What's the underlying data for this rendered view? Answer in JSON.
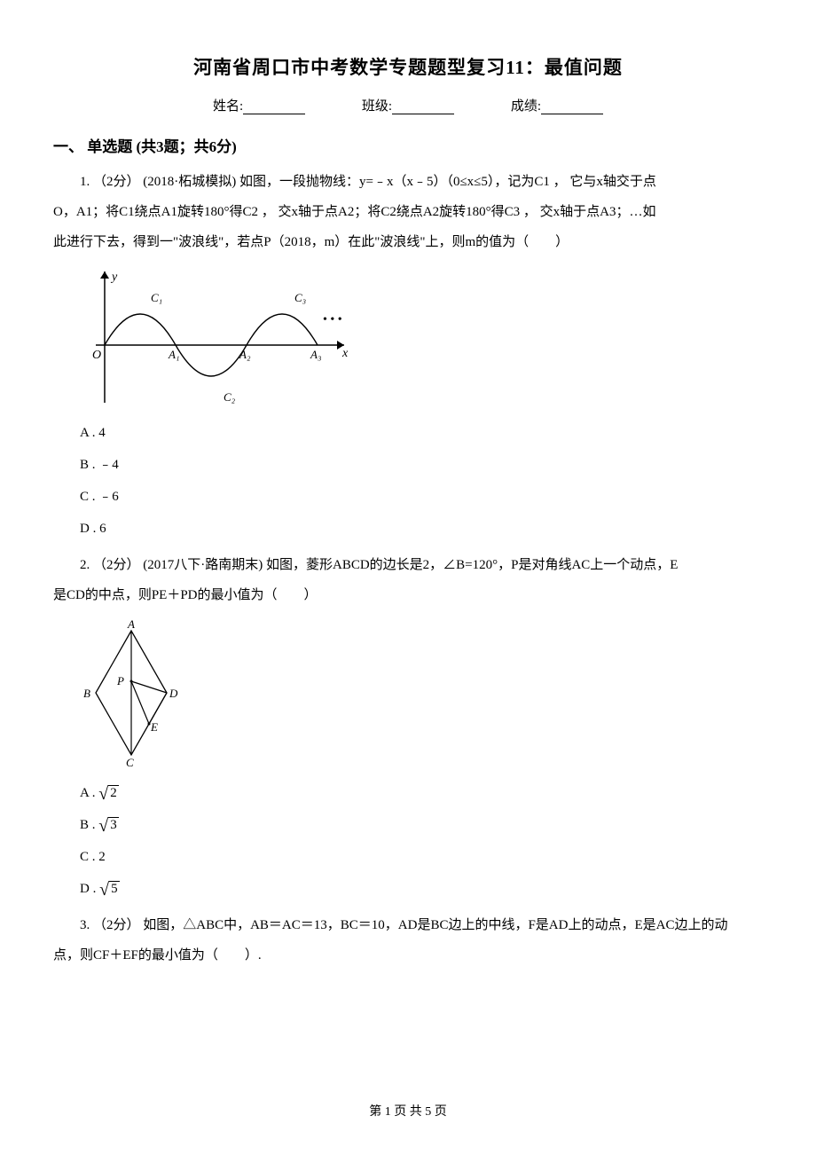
{
  "title": "河南省周口市中考数学专题题型复习11：最值问题",
  "fields": {
    "name_label": "姓名:",
    "class_label": "班级:",
    "score_label": "成绩:"
  },
  "section1": {
    "heading": "一、 单选题 (共3题；共6分)"
  },
  "q1": {
    "stem_line1": "1. （2分） (2018·柘城模拟) 如图，一段抛物线：y=﹣x（x﹣5）（0≤x≤5），记为C1 ， 它与x轴交于点",
    "stem_line2": "O，A1；将C1绕点A1旋转180°得C2 ， 交x轴于点A2；将C2绕点A2旋转180°得C3 ， 交x轴于点A3；…如",
    "stem_line3": "此进行下去，得到一\"波浪线\"，若点P（2018，m）在此\"波浪线\"上，则m的值为（　　）",
    "options": {
      "A": "A . 4",
      "B": "B . ﹣4",
      "C": "C . ﹣6",
      "D": "D . 6"
    },
    "figure_labels": {
      "y": "y",
      "x": "x",
      "O": "O",
      "A1": "A₁",
      "A2": "A₂",
      "A3": "A₃",
      "C1": "C₁",
      "C2": "C₂",
      "C3": "C₃",
      "dots": "• • •"
    }
  },
  "q2": {
    "stem_line1": "2. （2分） (2017八下·路南期末) 如图，菱形ABCD的边长是2，∠B=120°，P是对角线AC上一个动点，E",
    "stem_line2": "是CD的中点，则PE＋PD的最小值为（　　）",
    "options": {
      "A_prefix": "A . ",
      "A_val": "2",
      "B_prefix": "B . ",
      "B_val": "3",
      "C": "C . 2",
      "D_prefix": "D . ",
      "D_val": "5"
    },
    "figure_labels": {
      "A": "A",
      "B": "B",
      "C": "C",
      "D": "D",
      "P": "P",
      "E": "E"
    }
  },
  "q3": {
    "stem_line1": "3. （2分） 如图，△ABC中，AB＝AC＝13，BC＝10，AD是BC边上的中线，F是AD上的动点，E是AC边上的动",
    "stem_line2": "点，则CF＋EF的最小值为（　　）."
  },
  "pager": "第 1 页 共 5 页"
}
